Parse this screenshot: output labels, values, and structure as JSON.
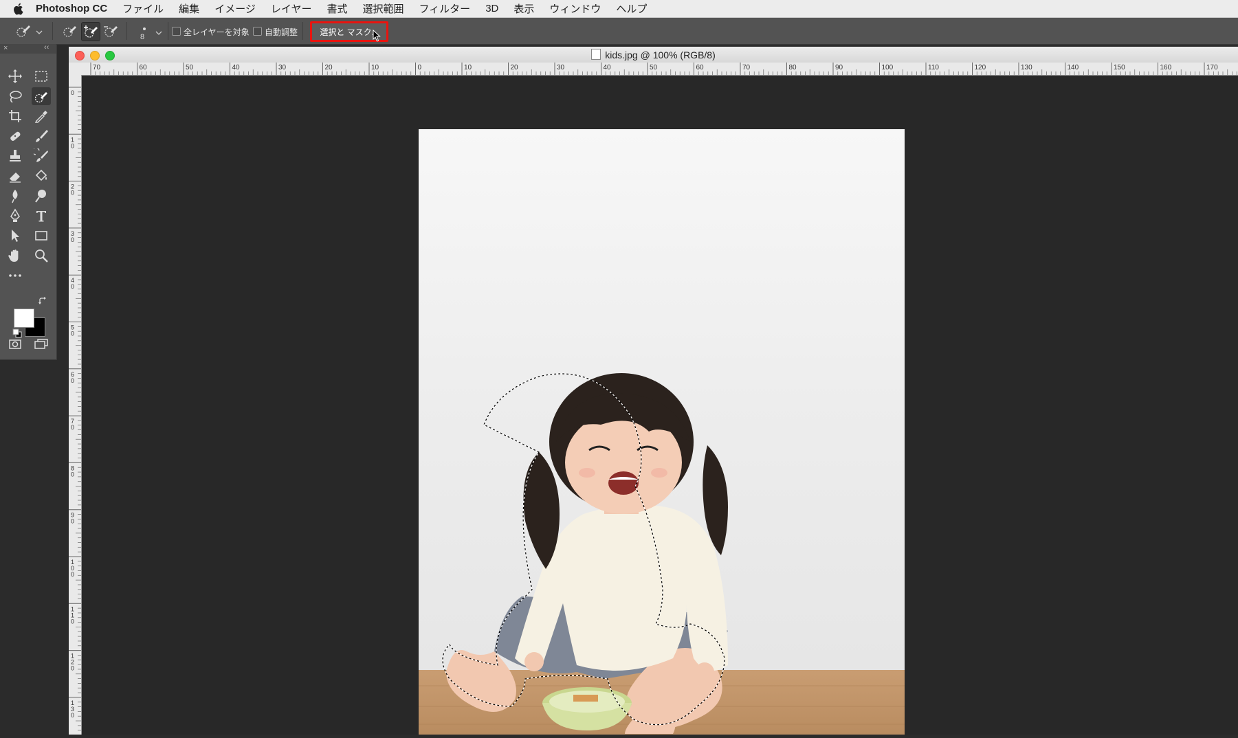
{
  "menubar": {
    "app_name": "Photoshop CC",
    "items": [
      "ファイル",
      "編集",
      "イメージ",
      "レイヤー",
      "書式",
      "選択範囲",
      "フィルター",
      "3D",
      "表示",
      "ウィンドウ",
      "ヘルプ"
    ]
  },
  "options_bar": {
    "brush_size": "8",
    "sample_all_layers_label": "全レイヤーを対象",
    "auto_enhance_label": "自動調整",
    "select_and_mask_label": "選択と マスク..."
  },
  "toolbox": {
    "tools": [
      "move",
      "rectangular-marquee",
      "lasso",
      "quick-selection",
      "crop",
      "eyedropper",
      "healing-brush",
      "brush",
      "clone-stamp",
      "history-brush",
      "eraser",
      "paint-bucket",
      "blur",
      "dodge",
      "pen",
      "type",
      "path-selection",
      "rectangle",
      "hand",
      "zoom",
      "more"
    ],
    "foreground_color": "#ffffff",
    "background_color": "#000000"
  },
  "document": {
    "title": "kids.jpg @ 100% (RGB/8)",
    "ruler_h_labels": [
      "70",
      "60",
      "50",
      "40",
      "30",
      "20",
      "10",
      "0",
      "10",
      "20",
      "30",
      "40",
      "50",
      "60",
      "70",
      "80",
      "90",
      "100",
      "110",
      "120",
      "130",
      "140",
      "150",
      "160",
      "170"
    ],
    "ruler_v_labels": [
      "0",
      "10",
      "20",
      "30",
      "40",
      "50",
      "60",
      "70",
      "80",
      "90",
      "100",
      "110",
      "120",
      "130"
    ]
  },
  "colors": {
    "highlight": "#e8140f",
    "panel": "#535353",
    "canvas_bg": "#282828"
  }
}
